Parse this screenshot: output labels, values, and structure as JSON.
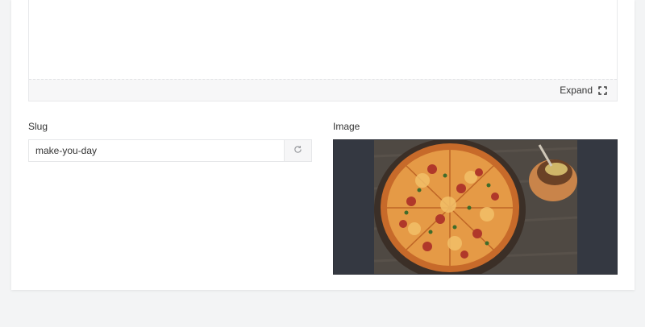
{
  "editor": {
    "expand_label": "Expand",
    "expand_icon": "expand-icon"
  },
  "slug": {
    "label": "Slug",
    "value": "make-you-day",
    "refresh_icon": "refresh-icon"
  },
  "image": {
    "label": "Image",
    "frame_color": "#343841"
  }
}
